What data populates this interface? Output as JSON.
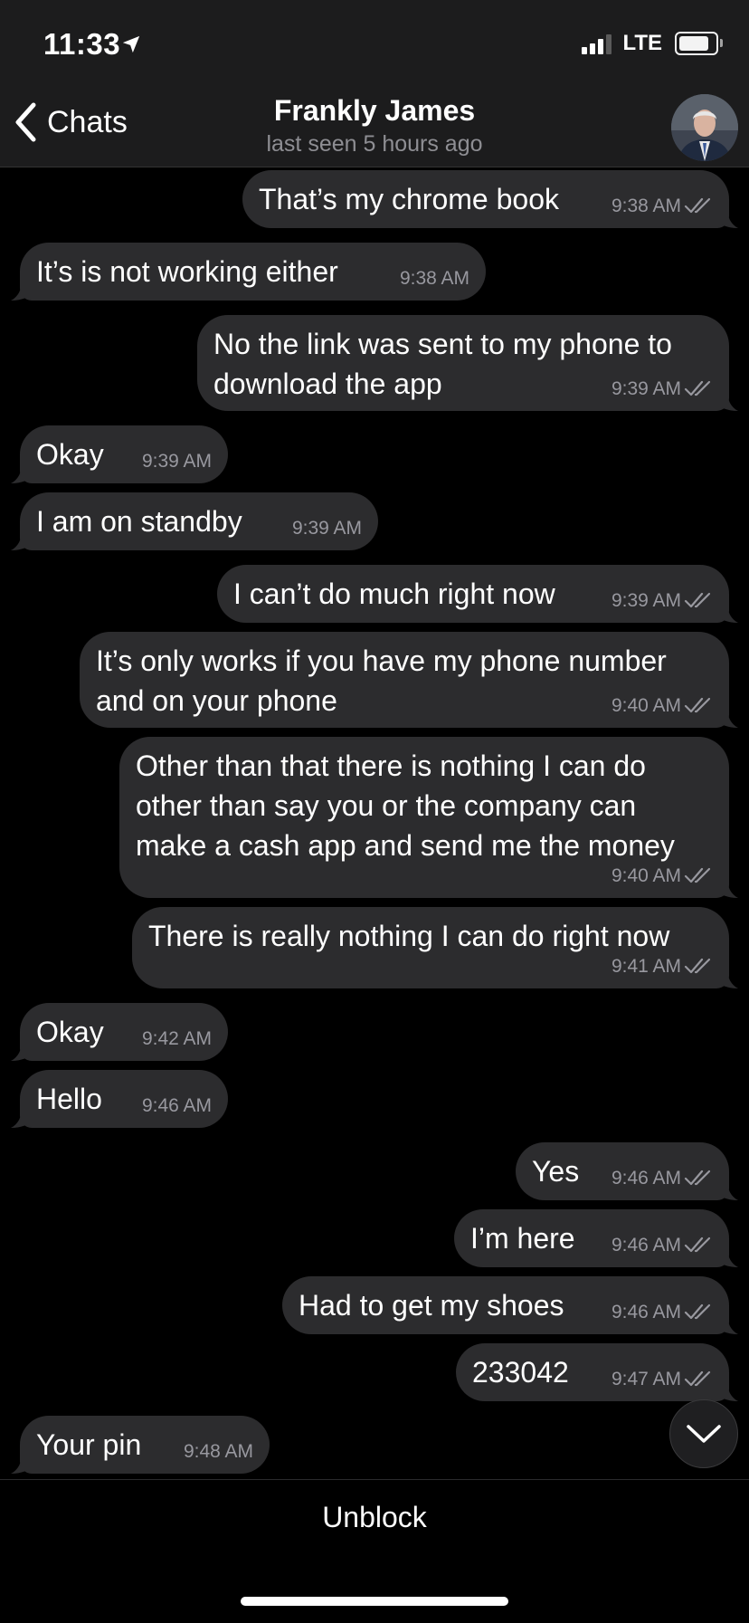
{
  "status_bar": {
    "time": "11:33",
    "network": "LTE",
    "battery_level": 0.85
  },
  "header": {
    "back_label": "Chats",
    "contact_name": "Frankly James",
    "contact_status": "last seen 5 hours ago"
  },
  "colors": {
    "background": "#000000",
    "bubble": "#2c2c2e",
    "meta": "#98989f"
  },
  "messages": [
    {
      "dir": "out",
      "text": "That’s my chrome book",
      "time": "9:38 AM",
      "read": true
    },
    {
      "dir": "in",
      "text": "It’s is not working either",
      "time": "9:38 AM"
    },
    {
      "dir": "out",
      "text": "No the link was sent to my phone to\ndownload the app",
      "time": "9:39 AM",
      "read": true
    },
    {
      "dir": "in",
      "text": "Okay",
      "time": "9:39 AM"
    },
    {
      "dir": "in",
      "text": "I am on standby",
      "time": "9:39 AM"
    },
    {
      "dir": "out",
      "text": "I can’t do much right now",
      "time": "9:39 AM",
      "read": true
    },
    {
      "dir": "out",
      "text": "It’s only works if you have my phone number\nand on your phone",
      "time": "9:40 AM",
      "read": true
    },
    {
      "dir": "out",
      "text": "Other than that there is nothing I can do\nother than say you or the company can\nmake a cash app and send me the money",
      "time": "9:40 AM",
      "read": true
    },
    {
      "dir": "out",
      "text": "There is really nothing I can do right now",
      "time": "9:41 AM",
      "read": true
    },
    {
      "dir": "in",
      "text": "Okay",
      "time": "9:42 AM"
    },
    {
      "dir": "in",
      "text": "Hello",
      "time": "9:46 AM"
    },
    {
      "dir": "out",
      "text": "Yes",
      "time": "9:46 AM",
      "read": true
    },
    {
      "dir": "out",
      "text": "I’m here",
      "time": "9:46 AM",
      "read": true
    },
    {
      "dir": "out",
      "text": "Had to get my shoes",
      "time": "9:46 AM",
      "read": true
    },
    {
      "dir": "out",
      "text": "233042",
      "time": "9:47 AM",
      "read": true
    },
    {
      "dir": "in",
      "text": "Your pin",
      "time": "9:48 AM"
    }
  ],
  "footer": {
    "unblock_label": "Unblock"
  }
}
